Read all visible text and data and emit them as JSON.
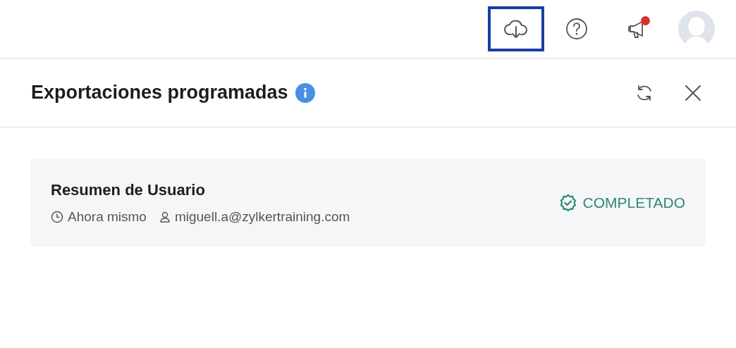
{
  "toolbar": [
    {
      "kind": "download",
      "selected": true,
      "notification": false
    },
    {
      "kind": "help",
      "selected": false,
      "notification": false
    },
    {
      "kind": "announcements",
      "selected": false,
      "notification": true
    },
    {
      "kind": "avatar",
      "selected": false,
      "notification": false
    }
  ],
  "panel": {
    "title": "Exportaciones programadas",
    "exports": [
      {
        "name": "Resumen de Usuario",
        "time": "Ahora mismo",
        "user": "miguell.a@zylkertraining.com",
        "status": {
          "kind": "completed",
          "label": "COMPLETADO"
        }
      }
    ]
  }
}
